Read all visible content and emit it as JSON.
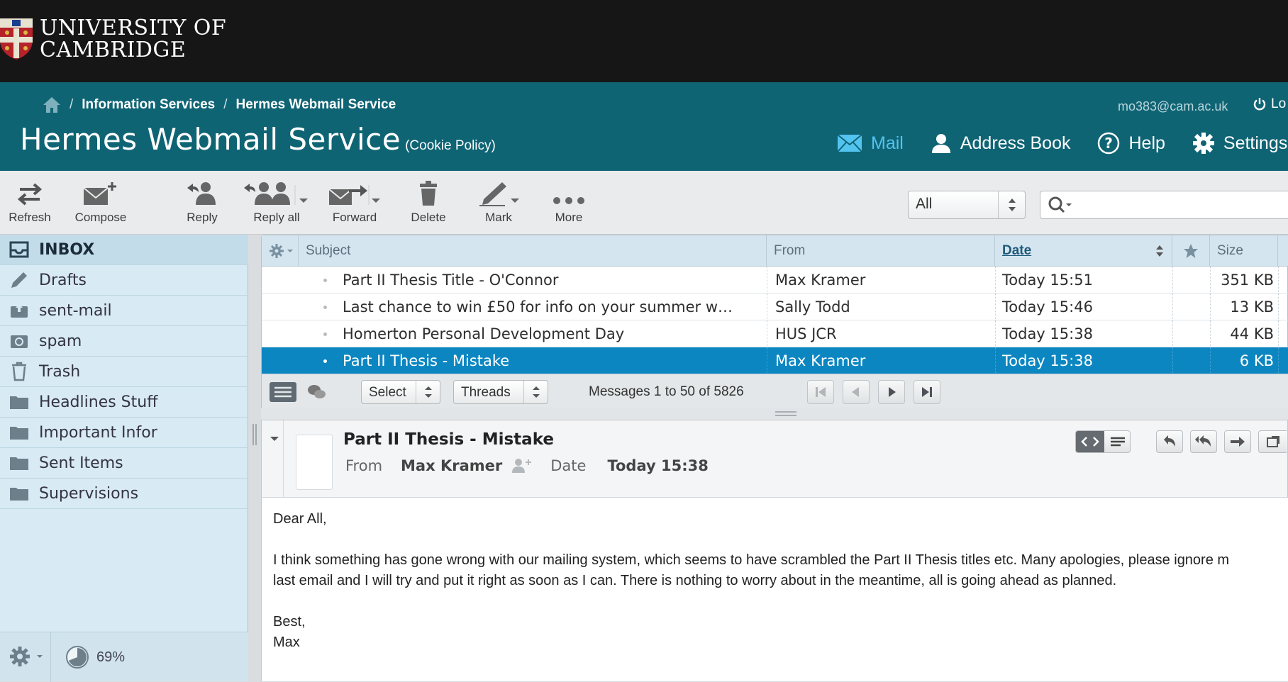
{
  "brand": {
    "line1": "UNIVERSITY OF",
    "line2": "CAMBRIDGE"
  },
  "breadcrumb": {
    "items": [
      "Information Services",
      "Hermes Webmail Service"
    ]
  },
  "header": {
    "title": "Hermes Webmail Service",
    "cookie_link": "(Cookie Policy)",
    "user_email": "mo383@cam.ac.uk",
    "logout_label": "Lo"
  },
  "nav": {
    "mail": "Mail",
    "address_book": "Address Book",
    "help": "Help",
    "settings": "Settings"
  },
  "toolbar": {
    "refresh": "Refresh",
    "compose": "Compose",
    "reply": "Reply",
    "reply_all": "Reply all",
    "forward": "Forward",
    "delete": "Delete",
    "mark": "Mark",
    "more": "More"
  },
  "search": {
    "filter_value": "All",
    "placeholder": ""
  },
  "folders": [
    {
      "label": "INBOX",
      "icon": "inbox-icon"
    },
    {
      "label": "Drafts",
      "icon": "pencil-icon"
    },
    {
      "label": "sent-mail",
      "icon": "sent-icon"
    },
    {
      "label": "spam",
      "icon": "spam-icon"
    },
    {
      "label": "Trash",
      "icon": "trash-icon"
    },
    {
      "label": "Headlines Stuff",
      "icon": "folder-icon"
    },
    {
      "label": "Important Infor",
      "icon": "folder-icon"
    },
    {
      "label": "Sent Items",
      "icon": "folder-icon"
    },
    {
      "label": "Supervisions",
      "icon": "folder-icon"
    }
  ],
  "quota": {
    "percent_label": "69%",
    "percent": 69
  },
  "list": {
    "columns": {
      "subject": "Subject",
      "from": "From",
      "date": "Date",
      "size": "Size"
    },
    "rows": [
      {
        "subject": "Part II Thesis Title - O'Connor",
        "from": "Max Kramer",
        "date": "Today 15:51",
        "size": "351 KB"
      },
      {
        "subject": "Last chance to win £50 for info on your summer w…",
        "from": "Sally Todd",
        "date": "Today 15:46",
        "size": "13 KB"
      },
      {
        "subject": "Homerton Personal Development Day",
        "from": "HUS JCR",
        "date": "Today 15:38",
        "size": "44 KB"
      },
      {
        "subject": "Part II Thesis - Mistake",
        "from": "Max Kramer",
        "date": "Today 15:38",
        "size": "6 KB"
      }
    ],
    "footer": {
      "select_label": "Select",
      "threads_label": "Threads",
      "count_text": "Messages 1 to 50 of 5826"
    }
  },
  "preview": {
    "subject": "Part II Thesis - Mistake",
    "from_label": "From",
    "from_value": "Max Kramer",
    "date_label": "Date",
    "date_value": "Today 15:38",
    "body": [
      "Dear All,",
      "I think something has gone wrong with our mailing system, which seems to have scrambled the Part II Thesis titles etc. Many apologies, please ignore m",
      "last email and I will try and put it right as soon as I can. There is nothing to worry about in the meantime, all is going ahead as planned.",
      "Best,",
      "Max"
    ]
  },
  "colors": {
    "teal": "#0f6474",
    "selected_row": "#0b86c1",
    "sidebar": "#d8eaf3",
    "mail_active": "#53c3f0"
  }
}
